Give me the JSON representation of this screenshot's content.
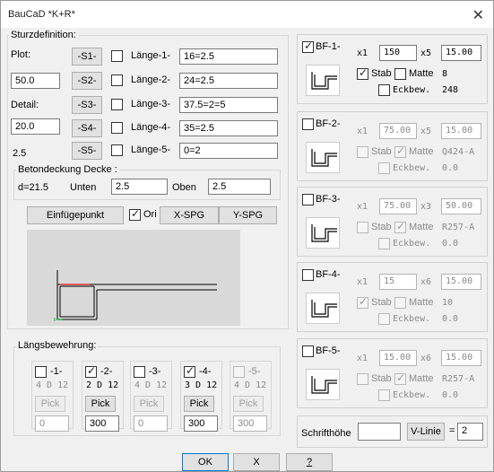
{
  "window": {
    "title": "BauCaD *K+R*"
  },
  "sturz": {
    "group_label": "Sturzdefinition:",
    "plot_label": "Plot:",
    "plot_value": "50.0",
    "detail_label": "Detail:",
    "detail_value": "20.0",
    "value_25": "2.5",
    "s_buttons": [
      "-S1-",
      "-S2-",
      "-S3-",
      "-S4-",
      "-S5-"
    ],
    "laengen": [
      {
        "label": "Länge-1-",
        "value": "16=2.5"
      },
      {
        "label": "Länge-2-",
        "value": "24=2.5"
      },
      {
        "label": "Länge-3-",
        "value": "37.5=2=5"
      },
      {
        "label": "Länge-4-",
        "value": "35=2.5"
      },
      {
        "label": "Länge-5-",
        "value": "0=2"
      }
    ]
  },
  "beton": {
    "label": "Betondeckung Decke :",
    "d_label": "d=21.5",
    "unten_label": "Unten",
    "unten_value": "2.5",
    "oben_label": "Oben",
    "oben_value": "2.5"
  },
  "toolbar": {
    "einfuege": "Einfügepunkt",
    "ori": "Ori",
    "xspg": "X-SPG",
    "yspg": "Y-SPG"
  },
  "laengs": {
    "label": "Längsbewehrung:",
    "pick_label": "Pick",
    "items": [
      {
        "label": "-1-",
        "spec": "4 D 12",
        "value": "0",
        "checked": false,
        "enabled": true
      },
      {
        "label": "-2-",
        "spec": "2 D 12",
        "value": "300",
        "checked": true,
        "enabled": true
      },
      {
        "label": "-3-",
        "spec": "4 D 12",
        "value": "0",
        "checked": false,
        "enabled": true
      },
      {
        "label": "-4-",
        "spec": "3 D 12",
        "value": "300",
        "checked": true,
        "enabled": true
      },
      {
        "label": "-5-",
        "spec": "4 D 12",
        "value": "300",
        "checked": false,
        "enabled": false
      }
    ]
  },
  "bf": [
    {
      "label": "BF-1-",
      "checked": true,
      "x_a": "x1",
      "a": "150",
      "x_b": "x5",
      "b": "15.00",
      "stab_label": "Stab",
      "stab": true,
      "matte_label": "Matte",
      "matte": false,
      "matte_val": "8",
      "eck_label": "Eckbew.",
      "eck": false,
      "eck_val": "248"
    },
    {
      "label": "BF-2-",
      "checked": false,
      "x_a": "x1",
      "a": "75.00",
      "x_b": "x5",
      "b": "15.00",
      "stab_label": "Stab",
      "stab": false,
      "matte_label": "Matte",
      "matte": true,
      "matte_val": "Q424-A",
      "eck_label": "Eckbew.",
      "eck": false,
      "eck_val": "0.0"
    },
    {
      "label": "BF-3-",
      "checked": false,
      "x_a": "x1",
      "a": "75.00",
      "x_b": "x3",
      "b": "50.00",
      "stab_label": "Stab",
      "stab": false,
      "matte_label": "Matte",
      "matte": true,
      "matte_val": "R257-A",
      "eck_label": "Eckbew.",
      "eck": false,
      "eck_val": "0.0"
    },
    {
      "label": "BF-4-",
      "checked": false,
      "x_a": "x1",
      "a": "15",
      "x_b": "x6",
      "b": "15.00",
      "stab_label": "Stab",
      "stab": true,
      "matte_label": "Matte",
      "matte": false,
      "matte_val": "10",
      "eck_label": "Eckbew.",
      "eck": false,
      "eck_val": "0.0"
    },
    {
      "label": "BF-5-",
      "checked": false,
      "x_a": "x1",
      "a": "15.00",
      "x_b": "x6",
      "b": "15.00",
      "stab_label": "Stab",
      "stab": false,
      "matte_label": "Matte",
      "matte": true,
      "matte_val": "R257-A",
      "eck_label": "Eckbew.",
      "eck": false,
      "eck_val": "0.0"
    }
  ],
  "schrift": {
    "label": "Schrifthöhe",
    "value": "",
    "vlinie": "V-Linie",
    "eq": "=",
    "eq_value": "2"
  },
  "footer": {
    "ok": "OK",
    "x": "X",
    "help": "?"
  }
}
